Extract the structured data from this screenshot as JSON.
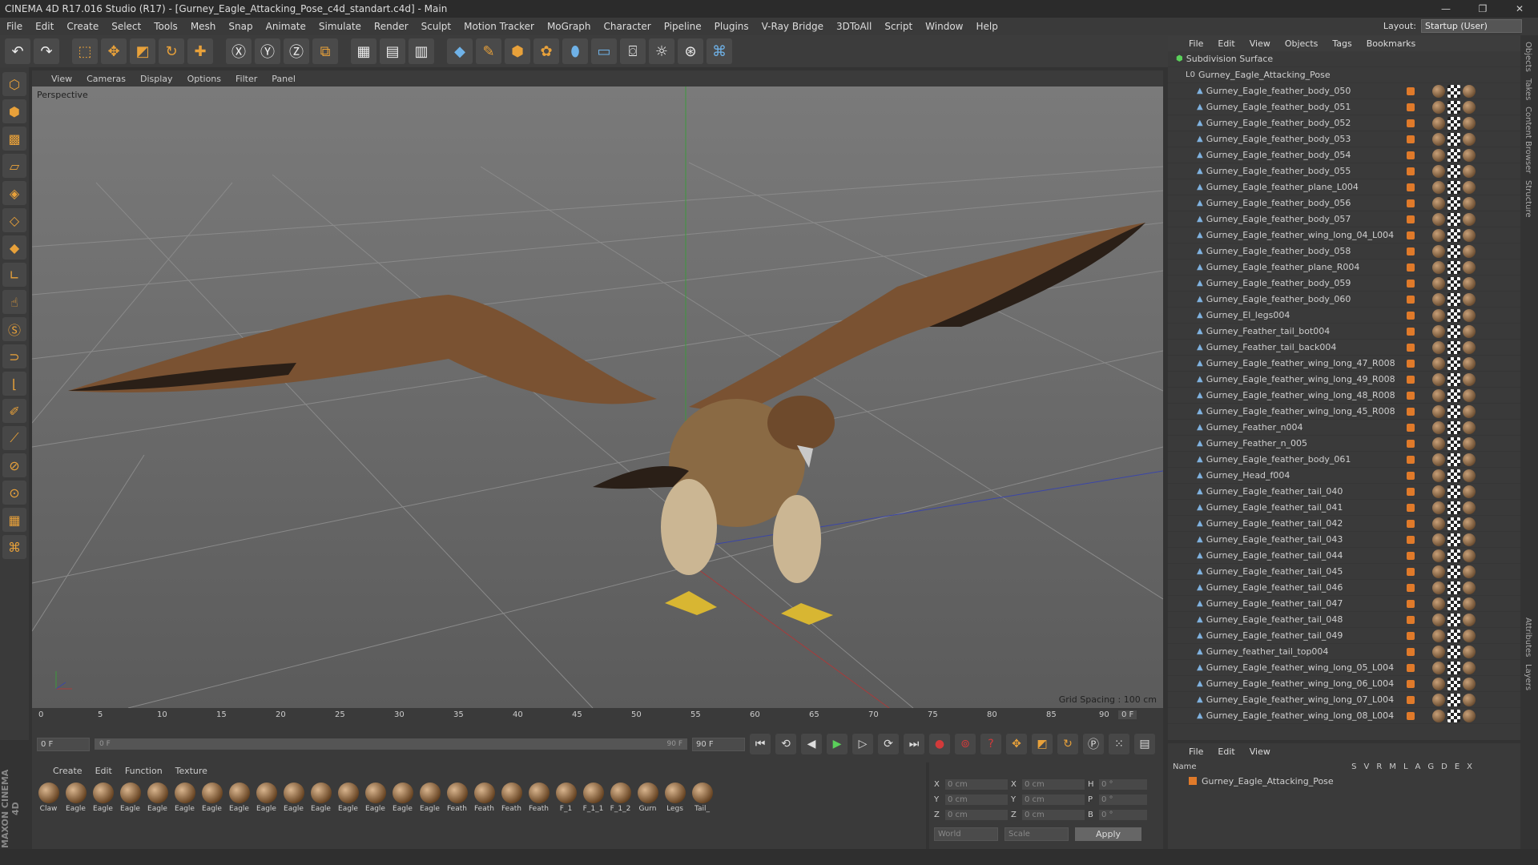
{
  "window": {
    "title": "CINEMA 4D R17.016 Studio (R17) - [Gurney_Eagle_Attacking_Pose_c4d_standart.c4d] - Main",
    "controls": [
      "—",
      "❐",
      "✕"
    ]
  },
  "menu": [
    "File",
    "Edit",
    "Create",
    "Select",
    "Tools",
    "Mesh",
    "Snap",
    "Animate",
    "Simulate",
    "Render",
    "Sculpt",
    "Motion Tracker",
    "MoGraph",
    "Character",
    "Pipeline",
    "Plugins",
    "V-Ray Bridge",
    "3DToAll",
    "Script",
    "Window",
    "Help"
  ],
  "layout": {
    "label": "Layout:",
    "value": "Startup (User)"
  },
  "viewport": {
    "menu": [
      "View",
      "Cameras",
      "Display",
      "Options",
      "Filter",
      "Panel"
    ],
    "label": "Perspective",
    "grid_spacing": "Grid Spacing : 100 cm"
  },
  "timeline": {
    "ticks": [
      "0",
      "5",
      "10",
      "15",
      "20",
      "25",
      "30",
      "35",
      "40",
      "45",
      "50",
      "55",
      "60",
      "65",
      "70",
      "75",
      "80",
      "85",
      "90"
    ],
    "current_frame": "0 F",
    "start_field": "0 F",
    "range_start": "0 F",
    "range_end": "90 F",
    "end_field": "90 F",
    "end_field2": "90 F"
  },
  "materials": {
    "menu": [
      "Create",
      "Edit",
      "Function",
      "Texture"
    ],
    "items": [
      "Claw",
      "Eagle",
      "Eagle",
      "Eagle",
      "Eagle",
      "Eagle",
      "Eagle",
      "Eagle",
      "Eagle",
      "Eagle",
      "Eagle",
      "Eagle",
      "Eagle",
      "Eagle",
      "Eagle",
      "Feath",
      "Feath",
      "Feath",
      "Feath",
      "F_1",
      "F_1_1",
      "F_1_2",
      "Gurn",
      "Legs",
      "Tail_"
    ]
  },
  "coords": {
    "rows": [
      {
        "a": "X",
        "av": "0 cm",
        "b": "X",
        "bv": "0 cm",
        "c": "H",
        "cv": "0 °"
      },
      {
        "a": "Y",
        "av": "0 cm",
        "b": "Y",
        "bv": "0 cm",
        "c": "P",
        "cv": "0 °"
      },
      {
        "a": "Z",
        "av": "0 cm",
        "b": "Z",
        "bv": "0 cm",
        "c": "B",
        "cv": "0 °"
      }
    ],
    "space": "World",
    "mode": "Scale",
    "apply": "Apply"
  },
  "objects": {
    "menu": [
      "File",
      "Edit",
      "View",
      "Objects",
      "Tags",
      "Bookmarks"
    ],
    "root": "Subdivision Surface",
    "group": "Gurney_Eagle_Attacking_Pose",
    "items": [
      "Gurney_Eagle_feather_body_050",
      "Gurney_Eagle_feather_body_051",
      "Gurney_Eagle_feather_body_052",
      "Gurney_Eagle_feather_body_053",
      "Gurney_Eagle_feather_body_054",
      "Gurney_Eagle_feather_body_055",
      "Gurney_Eagle_feather_plane_L004",
      "Gurney_Eagle_feather_body_056",
      "Gurney_Eagle_feather_body_057",
      "Gurney_Eagle_feather_wing_long_04_L004",
      "Gurney_Eagle_feather_body_058",
      "Gurney_Eagle_feather_plane_R004",
      "Gurney_Eagle_feather_body_059",
      "Gurney_Eagle_feather_body_060",
      "Gurney_El_legs004",
      "Gurney_Feather_tail_bot004",
      "Gurney_Feather_tail_back004",
      "Gurney_Eagle_feather_wing_long_47_R008",
      "Gurney_Eagle_feather_wing_long_49_R008",
      "Gurney_Eagle_feather_wing_long_48_R008",
      "Gurney_Eagle_feather_wing_long_45_R008",
      "Gurney_Feather_n004",
      "Gurney_Feather_n_005",
      "Gurney_Eagle_feather_body_061",
      "Gurney_Head_f004",
      "Gurney_Eagle_feather_tail_040",
      "Gurney_Eagle_feather_tail_041",
      "Gurney_Eagle_feather_tail_042",
      "Gurney_Eagle_feather_tail_043",
      "Gurney_Eagle_feather_tail_044",
      "Gurney_Eagle_feather_tail_045",
      "Gurney_Eagle_feather_tail_046",
      "Gurney_Eagle_feather_tail_047",
      "Gurney_Eagle_feather_tail_048",
      "Gurney_Eagle_feather_tail_049",
      "Gurney_feather_tail_top004",
      "Gurney_Eagle_feather_wing_long_05_L004",
      "Gurney_Eagle_feather_wing_long_06_L004",
      "Gurney_Eagle_feather_wing_long_07_L004",
      "Gurney_Eagle_feather_wing_long_08_L004"
    ]
  },
  "layers": {
    "menu": [
      "File",
      "Edit",
      "View"
    ],
    "header_name": "Name",
    "cols": [
      "S",
      "V",
      "R",
      "M",
      "L",
      "A",
      "G",
      "D",
      "E",
      "X"
    ],
    "row": "Gurney_Eagle_Attacking_Pose"
  },
  "right_tabs": [
    "Objects",
    "Takes",
    "Content Browser",
    "Structure",
    "Attributes",
    "Layers"
  ],
  "maxon": "MAXON CINEMA 4D"
}
